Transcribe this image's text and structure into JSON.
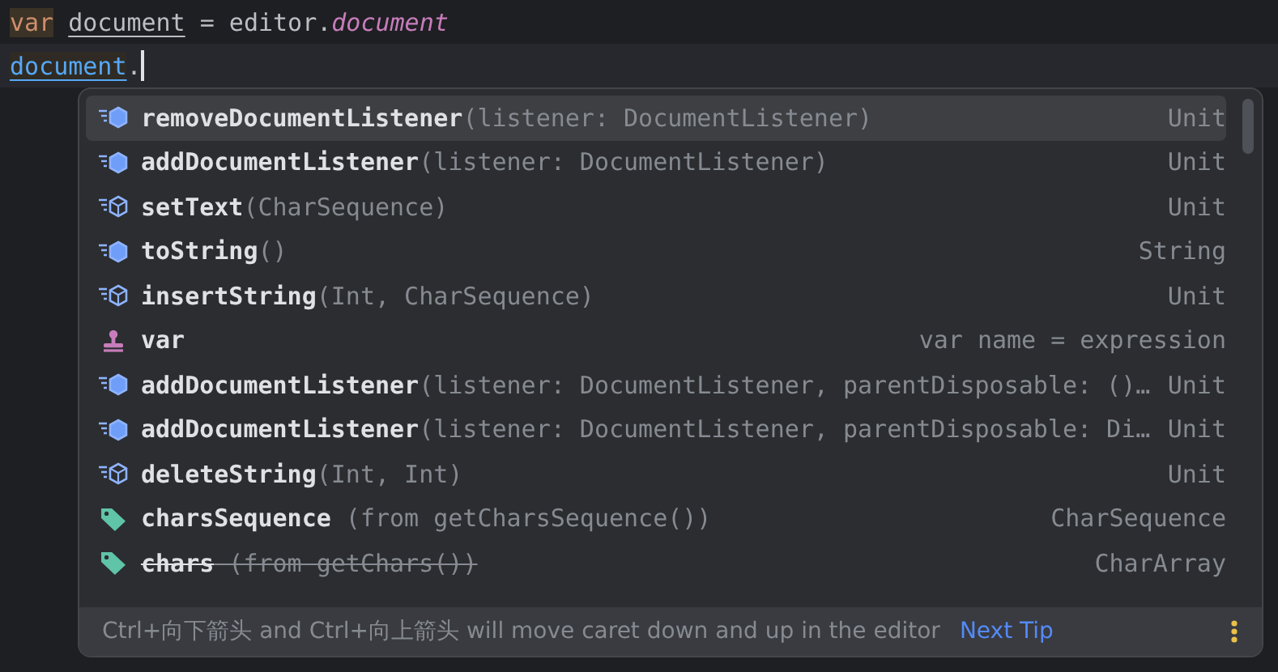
{
  "editor": {
    "lines": [
      {
        "current": false,
        "tokens": [
          {
            "text": "var",
            "kind": "keyword"
          },
          {
            "text": "document",
            "kind": "declaration"
          },
          {
            "text": " = editor.",
            "kind": "plain"
          },
          {
            "text": "document",
            "kind": "property"
          }
        ]
      },
      {
        "current": true,
        "tokens": [
          {
            "text": "document",
            "kind": "reference"
          },
          {
            "text": ".",
            "kind": "plain"
          }
        ]
      }
    ]
  },
  "completion": {
    "items": [
      {
        "kind": "method",
        "name": "removeDocumentListener",
        "detail": "(listener: DocumentListener)",
        "type": "Unit",
        "selected": true,
        "deprecated": false
      },
      {
        "kind": "method",
        "name": "addDocumentListener",
        "detail": "(listener: DocumentListener)",
        "type": "Unit",
        "selected": false,
        "deprecated": false
      },
      {
        "kind": "abstract",
        "name": "setText",
        "detail": "(CharSequence)",
        "type": "Unit",
        "selected": false,
        "deprecated": false
      },
      {
        "kind": "method",
        "name": "toString",
        "detail": "()",
        "type": "String",
        "selected": false,
        "deprecated": false
      },
      {
        "kind": "abstract",
        "name": "insertString",
        "detail": "(Int, CharSequence)",
        "type": "Unit",
        "selected": false,
        "deprecated": false
      },
      {
        "kind": "template",
        "name": "var",
        "type": "var name = expression",
        "selected": false,
        "deprecated": false
      },
      {
        "kind": "method",
        "name": "addDocumentListener",
        "detail": "(listener: DocumentListener, parentDisposable: ()…",
        "type": "Unit",
        "selected": false,
        "deprecated": false
      },
      {
        "kind": "method",
        "name": "addDocumentListener",
        "detail": "(listener: DocumentListener, parentDisposable: Di…",
        "type": "Unit",
        "selected": false,
        "deprecated": false
      },
      {
        "kind": "abstract",
        "name": "deleteString",
        "detail": "(Int, Int)",
        "type": "Unit",
        "selected": false,
        "deprecated": false
      },
      {
        "kind": "property",
        "name": "charsSequence",
        "detail": " (from getCharsSequence())",
        "type": "CharSequence",
        "selected": false,
        "deprecated": false
      },
      {
        "kind": "property",
        "name": "chars",
        "detail": " (from getChars())",
        "type": "CharArray",
        "selected": false,
        "deprecated": true
      }
    ],
    "footer": {
      "hint": "Ctrl+向下箭头 and Ctrl+向上箭头 will move caret down and up in the editor",
      "link": "Next Tip"
    }
  }
}
